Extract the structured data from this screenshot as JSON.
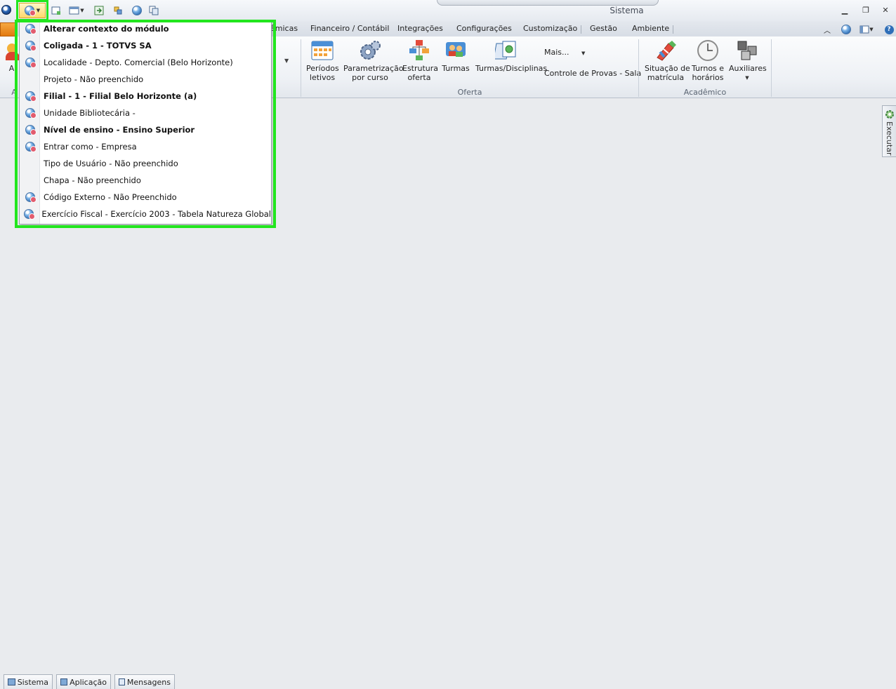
{
  "titlebar": {
    "window_title": "Sistema"
  },
  "ribbon_tabs": {
    "partial_tab": "êmicas",
    "tabs": [
      "Financeiro / Contábil",
      "Integrações",
      "Configurações",
      "Customização",
      "Gestão",
      "Ambiente"
    ]
  },
  "ribbon": {
    "partial_left_label": "Al",
    "partial_left_group": "A",
    "groups": {
      "oferta": {
        "label": "Oferta",
        "buttons": [
          {
            "line1": "Períodos",
            "line2": "letivos",
            "icon": "calendar-icon"
          },
          {
            "line1": "Parametrização",
            "line2": "por curso",
            "icon": "gears-icon"
          },
          {
            "line1": "Estrutura",
            "line2": "oferta",
            "icon": "structure-icon"
          },
          {
            "line1": "Turmas",
            "line2": "",
            "icon": "users-icon"
          },
          {
            "line1": "Turmas/Disciplinas",
            "line2": "",
            "icon": "books-icon"
          }
        ],
        "mais_label": "Mais...",
        "controle_label": "Controle de Provas - Sala"
      },
      "academico": {
        "label": "Acadêmico",
        "buttons": [
          {
            "line1": "Situação de",
            "line2": "matrícula",
            "icon": "pencil-icon"
          },
          {
            "line1": "Turnos e",
            "line2": "horários",
            "icon": "clock-icon"
          },
          {
            "line1": "Auxiliares",
            "line2": "",
            "icon": "cubes-icon"
          }
        ]
      }
    }
  },
  "context_menu": {
    "items": [
      {
        "label": "Alterar contexto do módulo",
        "bold": true,
        "icon": "context-globe-icon"
      },
      {
        "label": "Coligada - 1 - TOTVS SA",
        "bold": true,
        "icon": "context-globe-icon"
      },
      {
        "label": "Localidade - Depto. Comercial (Belo Horizonte)",
        "bold": false,
        "icon": "context-globe-icon"
      },
      {
        "label": "Projeto - Não preenchido",
        "bold": false,
        "icon": ""
      },
      {
        "label": "Filial - 1 - Filial Belo Horizonte (a)",
        "bold": true,
        "icon": "context-globe-icon"
      },
      {
        "label": "Unidade Bibliotecária -",
        "bold": false,
        "icon": "context-globe-icon"
      },
      {
        "label": "Nível de ensino - Ensino Superior",
        "bold": true,
        "icon": "context-globe-icon"
      },
      {
        "label": "Entrar como - Empresa",
        "bold": false,
        "icon": "context-globe-icon"
      },
      {
        "label": "Tipo de Usuário - Não preenchido",
        "bold": false,
        "icon": ""
      },
      {
        "label": "Chapa - Não preenchido",
        "bold": false,
        "icon": ""
      },
      {
        "label": "Código Externo - Não Preenchido",
        "bold": false,
        "icon": "context-globe-icon"
      },
      {
        "label": "Exercício Fiscal - Exercício 2003 - Tabela Natureza Global",
        "bold": false,
        "icon": "context-globe-icon"
      }
    ]
  },
  "side_panel": {
    "executar_label": "Executar"
  },
  "statusbar": {
    "tabs": [
      "Sistema",
      "Aplicação",
      "Mensagens"
    ]
  },
  "colors": {
    "highlight": "#22e61e",
    "file_tab": "#e27a10"
  }
}
